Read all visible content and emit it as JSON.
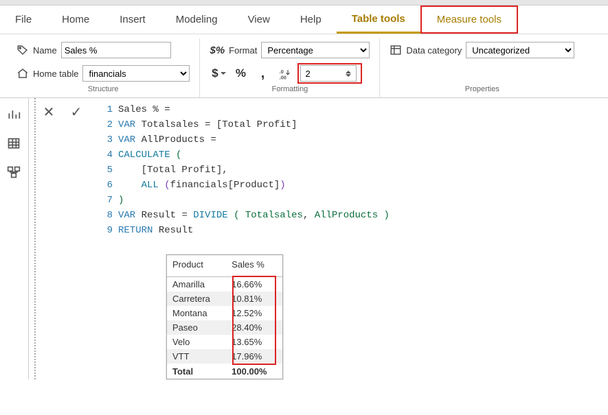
{
  "menu": {
    "file": "File",
    "home": "Home",
    "insert": "Insert",
    "modeling": "Modeling",
    "view": "View",
    "help": "Help",
    "table_tools": "Table tools",
    "measure_tools": "Measure tools"
  },
  "structure": {
    "name_label": "Name",
    "name_value": "Sales %",
    "home_table_label": "Home table",
    "home_table_value": "financials",
    "group_title": "Structure"
  },
  "formatting": {
    "label": "Format",
    "value": "Percentage",
    "decimals": "2",
    "group_title": "Formatting"
  },
  "properties": {
    "label": "Data category",
    "value": "Uncategorized",
    "group_title": "Properties"
  },
  "formula": {
    "l1a": "Sales % ",
    "l1b": "=",
    "l2a": "VAR",
    "l2b": " Totalsales ",
    "l2c": "=",
    "l2d": " [Total Profit]",
    "l3a": "VAR",
    "l3b": " AllProducts ",
    "l3c": "=",
    "l4a": "CALCULATE",
    "l4b": " (",
    "l5a": "    [Total Profit]",
    "l5b": ",",
    "l6a": "    ",
    "l6b": "ALL",
    "l6c": " (",
    "l6d": "financials[Product]",
    "l6e": ")",
    "l7a": ")",
    "l8a": "VAR",
    "l8b": " Result ",
    "l8c": "=",
    "l8d": " ",
    "l8e": "DIVIDE",
    "l8f": " ( Totalsales",
    "l8g": ",",
    "l8h": " AllProducts )",
    "l9a": "RETURN",
    "l9b": " Result"
  },
  "table": {
    "col1": "Product",
    "col2": "Sales %",
    "rows": [
      {
        "p": "Amarilla",
        "v": "16.66%"
      },
      {
        "p": "Carretera",
        "v": "10.81%"
      },
      {
        "p": "Montana",
        "v": "12.52%"
      },
      {
        "p": "Paseo",
        "v": "28.40%"
      },
      {
        "p": "Velo",
        "v": "13.65%"
      },
      {
        "p": "VTT",
        "v": "17.96%"
      }
    ],
    "total_label": "Total",
    "total_value": "100.00%"
  },
  "chart_data": {
    "type": "table",
    "title": "Sales %",
    "categories": [
      "Amarilla",
      "Carretera",
      "Montana",
      "Paseo",
      "Velo",
      "VTT"
    ],
    "values": [
      16.66,
      10.81,
      12.52,
      28.4,
      13.65,
      17.96
    ],
    "total": 100.0,
    "xlabel": "Product",
    "ylabel": "Sales %"
  }
}
